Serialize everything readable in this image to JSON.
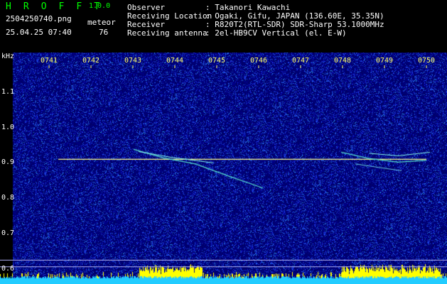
{
  "header": {
    "app_title": "H R O F F T",
    "app_version": "1.0.0",
    "filename": "2504250740.png",
    "meteor_label": "meteor",
    "datetime": "25.04.25 07:40",
    "meteor_count": "76"
  },
  "info": [
    {
      "label": "Observer",
      "value": ": Takanori Kawachi"
    },
    {
      "label": "Receiving Location",
      "value": ": Ogaki, Gifu, JAPAN (136.60E, 35.35N)"
    },
    {
      "label": "Receiver",
      "value": ": R820T2(RTL-SDR) SDR-Sharp 53.1000MHz"
    },
    {
      "label": "Receiving antenna",
      "value": ": 2el-HB9CV Vertical (el. E-W)"
    }
  ],
  "chart_data": {
    "type": "heatmap",
    "ylabel": "kHz",
    "x_ticks": [
      "0741",
      "0742",
      "0743",
      "0744",
      "0745",
      "0746",
      "0747",
      "0748",
      "0749",
      "0750"
    ],
    "y_ticks": [
      "1.1",
      "1.0",
      "0.9",
      "0.8",
      "0.7",
      "0.6"
    ],
    "ylim": [
      0.58,
      1.2
    ],
    "carrier_khz": 0.908,
    "reference_lines_khz": [
      0.623,
      0.604
    ],
    "colors": {
      "background": "#000066",
      "noise": "#2233cc",
      "trace": "#55ddcc",
      "carrier": "#ffff88",
      "level": "#ffff00",
      "base": "#22ccff"
    }
  }
}
